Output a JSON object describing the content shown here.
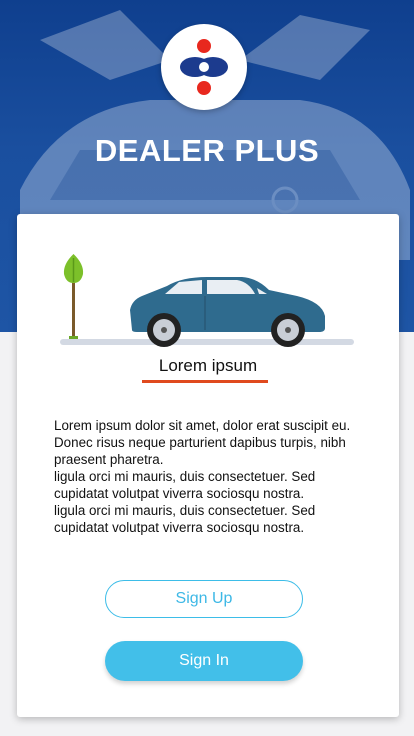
{
  "app": {
    "title": "DEALER PLUS",
    "logo_icon": "dealer-plus-logo-icon"
  },
  "colors": {
    "brand_blue": "#1a4f9f",
    "accent_orange": "#e04a1e",
    "button_blue": "#42bfe9",
    "logo_red": "#e8281e",
    "logo_navy": "#1c3b8e"
  },
  "card": {
    "illustration_icons": [
      "tree-icon",
      "car-icon"
    ],
    "heading": "Lorem ipsum",
    "body": "Lorem ipsum dolor sit amet, dolor erat suscipit eu. Donec risus neque parturient dapibus turpis, nibh praesent pharetra.\nligula orci mi mauris, duis consectetuer. Sed cupidatat volutpat viverra sociosqu nostra.\nligula orci mi mauris, duis consectetuer. Sed cupidatat volutpat viverra sociosqu nostra."
  },
  "buttons": {
    "signup_label": "Sign Up",
    "signin_label": "Sign In"
  }
}
